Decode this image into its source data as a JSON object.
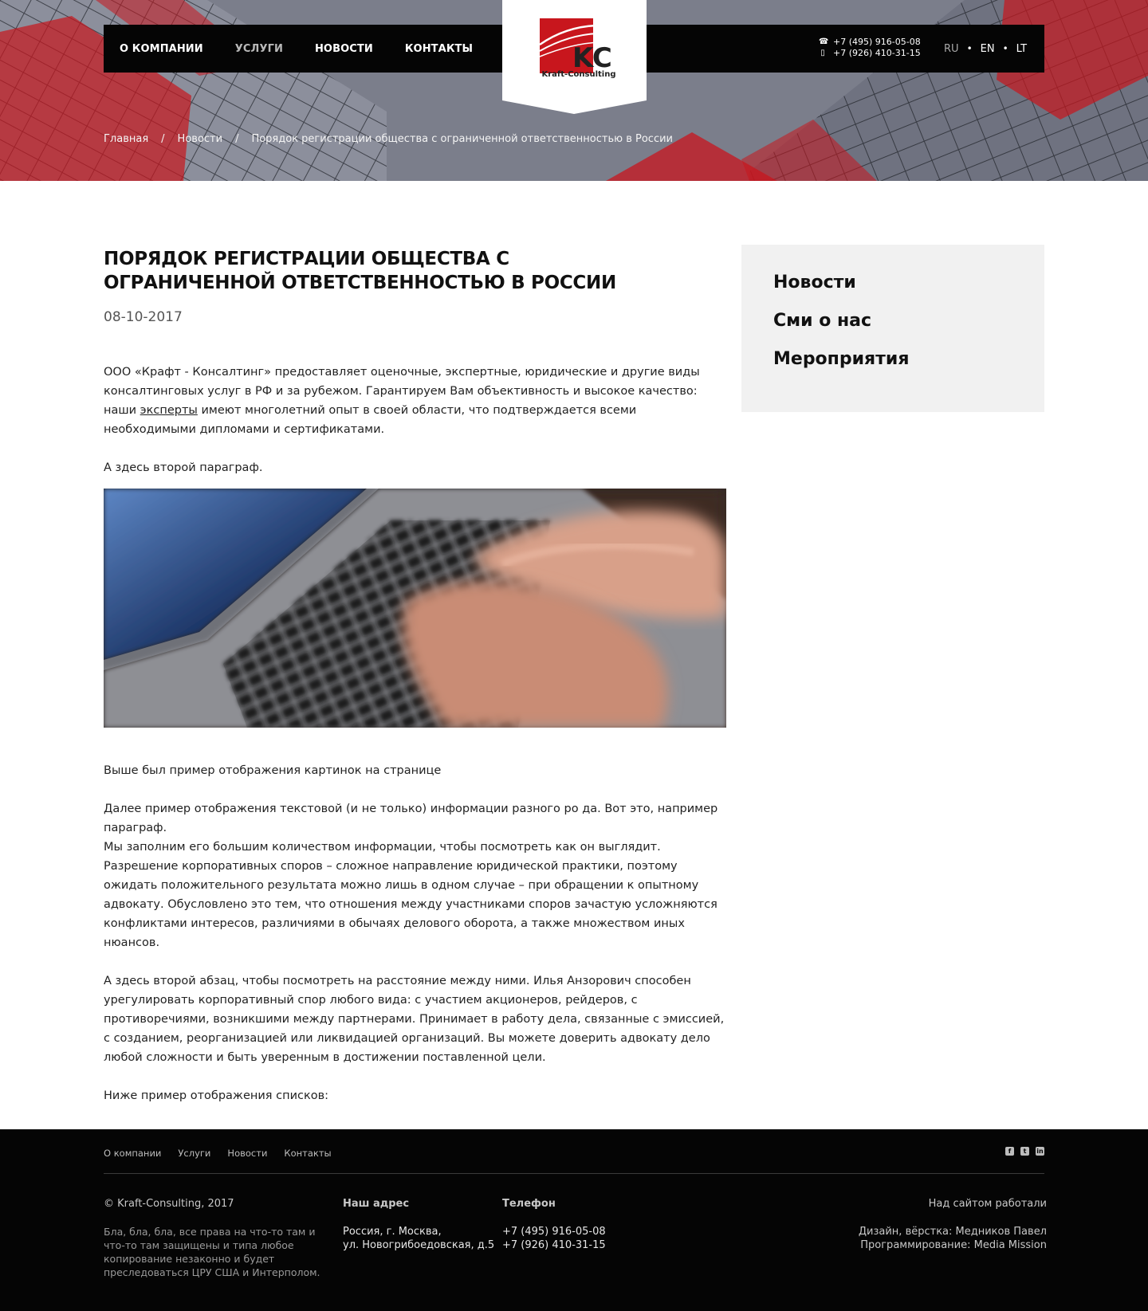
{
  "header": {
    "nav": [
      "О компании",
      "Услуги",
      "Новости",
      "Контакты"
    ],
    "nav_active_index": 1,
    "phones": [
      "+7 (495) 916-05-08",
      "+7 (926) 410-31-15"
    ],
    "languages": [
      "RU",
      "EN",
      "LT"
    ],
    "language_active": "RU",
    "logo": {
      "mark": "KC",
      "name": "Kraft-Consulting"
    },
    "colors": {
      "accent_red": "#c8161d",
      "nav_bg": "#050505"
    }
  },
  "breadcrumb": [
    "Главная",
    "Новости",
    "Порядок регистрации общества с ограниченной ответственностью в России"
  ],
  "article": {
    "title": "Порядок регистрации общества с ограниченной ответственностью в России",
    "date": "08-10-2017",
    "p1_before_link": "ООО «Крафт - Консалтинг» предоставляет оценочные, экспертные, юридические и другие виды консалтинговых услуг в РФ и за рубежом. Гарантируем Вам объективность и высокое качество: наши ",
    "p1_link": "эксперты",
    "p1_after_link": " имеют многолетний опыт в своей области, что подтверждается всеми необходимыми дипломами и сертификатами.",
    "p2": "А здесь второй параграф.",
    "p3": "Выше был пример отображения картинок на странице",
    "p4_line1": "Далее пример отображения текстовой (и не только) информации разного ро да. Вот это, например параграф.",
    "p4_line2": "Мы заполним его большим количеством информации, чтобы посмотреть как он выглядит.",
    "p4_line3": "Разрешение корпоративных споров – сложное направление юридической практики, поэтому ожидать положительного результата можно лишь в одном случае – при обращении к опытному адвокату. Обусловлено это тем, что отношения между участниками споров зачастую усложняются конфликтами интересов, различиями в обычаях делового оборота, а также множеством иных нюансов.",
    "p5": "А здесь второй абзац, чтобы посмотреть на расстояние между ними. Илья Анзорович способен урегулировать корпоративный спор любого вида: с участием акционеров, рейдеров, с противоречиями, возникшими между партнерами. Принимает в работу дела, связанные с эмиссией, с созданием, реорганизацией или ликвидацией организаций. Вы можете доверить адвокату дело любой сложности и быть уверенным в достижении поставленной цели.",
    "p6": "Ниже пример отображения списков:"
  },
  "sidebar": [
    "Новости",
    "Сми о нас",
    "Мероприятия"
  ],
  "footer": {
    "nav": [
      "О компании",
      "Услуги",
      "Новости",
      "Контакты"
    ],
    "social": [
      "facebook-icon",
      "twitter-icon",
      "linkedin-icon"
    ],
    "copyright": "© Kraft-Consulting, 2017",
    "legal": "Бла, бла, бла, все права на что-то там и что-то там защищены и типа любое копирование незаконно и будет преследоваться ЦРУ США и Интерполом.",
    "address_title": "Наш адрес",
    "address_line1": "Россия, г. Москва,",
    "address_line2": "ул. Новогрибоедовская, д.5",
    "phone_title": "Телефон",
    "phone1": "+7 (495) 916-05-08",
    "phone2": "+7 (926) 410-31-15",
    "credits_title": "Над сайтом работали",
    "credits_design": "Дизайн, вёрстка: Медников Павел",
    "credits_dev": "Программирование: Media Mission"
  }
}
